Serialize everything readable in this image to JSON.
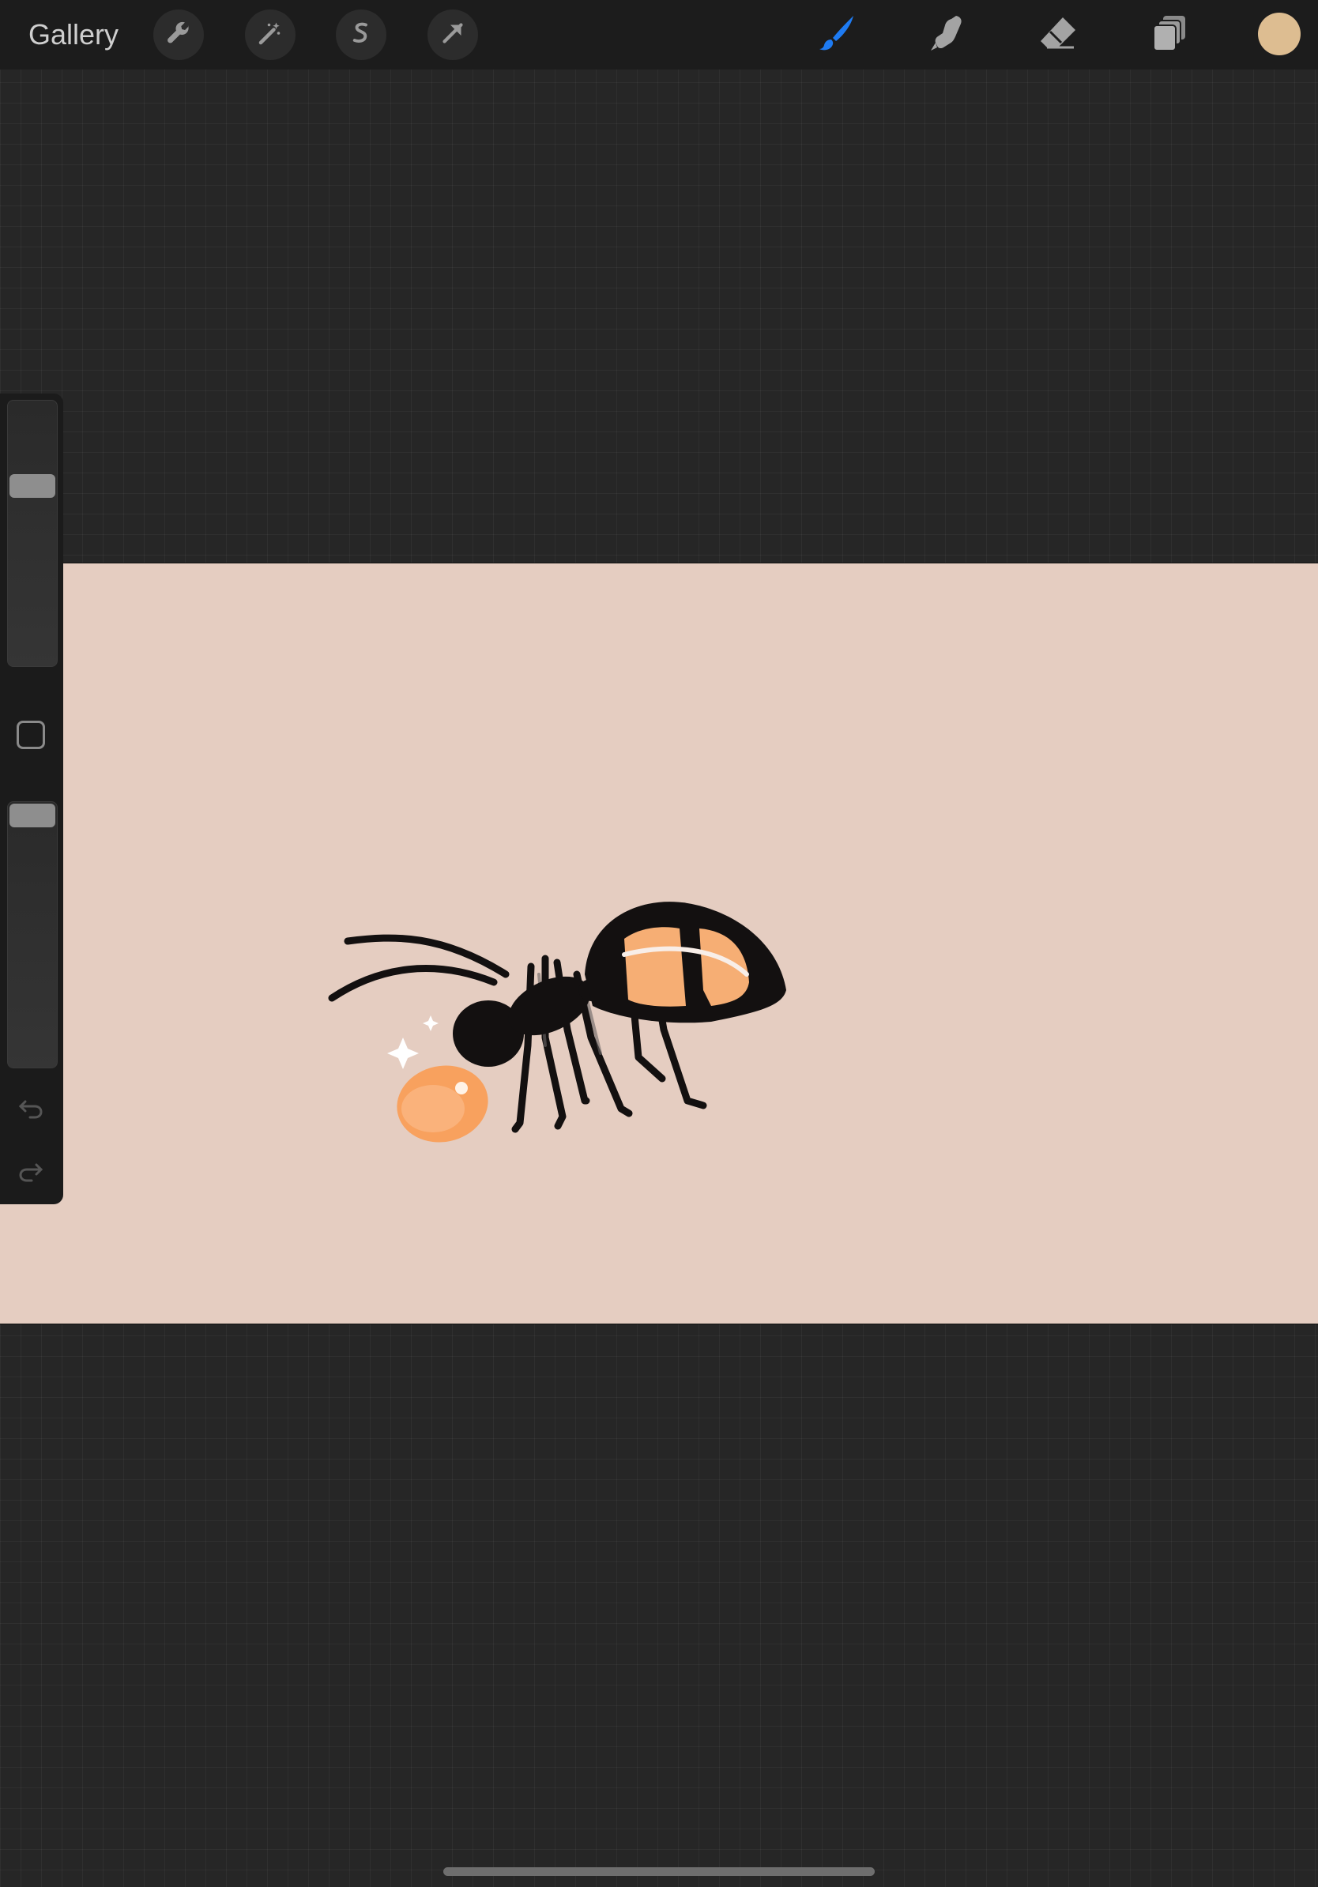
{
  "topbar": {
    "gallery_label": "Gallery",
    "left_tools": [
      {
        "name": "actions",
        "icon": "wrench-icon"
      },
      {
        "name": "adjustments",
        "icon": "magic-wand-icon"
      },
      {
        "name": "selection",
        "icon": "selection-s-icon"
      },
      {
        "name": "transform",
        "icon": "arrow-cursor-icon"
      }
    ],
    "right_tools": [
      {
        "name": "brush",
        "icon": "brush-icon",
        "active": true
      },
      {
        "name": "smudge",
        "icon": "smudge-finger-icon",
        "active": false
      },
      {
        "name": "eraser",
        "icon": "eraser-icon",
        "active": false
      },
      {
        "name": "layers",
        "icon": "layers-icon",
        "active": false
      }
    ],
    "active_color": "#DDBD91",
    "active_tool_color": "#1E7BF2"
  },
  "sidebar": {
    "brush_size_level": 0.7,
    "opacity_level": 1.0,
    "modify_icon": "modify-square-icon",
    "undo_icon": "undo-icon",
    "redo_icon": "redo-icon"
  },
  "canvas": {
    "background_color": "#E5CDC1",
    "subject": "ant-with-honey-drop"
  },
  "colors": {
    "workspace": "#262626",
    "toolbar": "#1C1C1C",
    "ant_body": "#131010",
    "ant_highlight": "#F6AE74",
    "honey_drop": "#F8A15E"
  }
}
